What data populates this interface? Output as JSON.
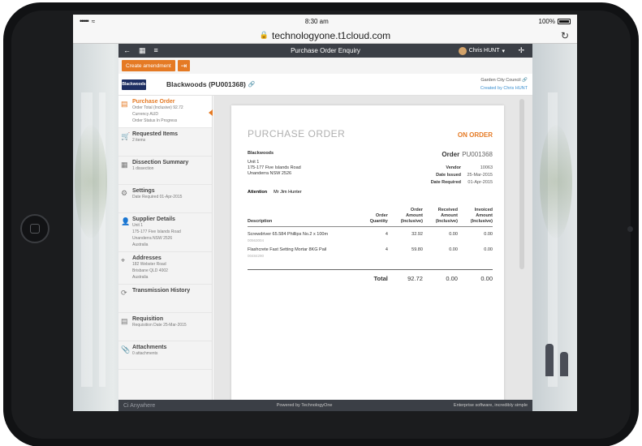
{
  "status_bar": {
    "signal": "•••••",
    "time": "8:30 am",
    "battery": "100%"
  },
  "browser": {
    "url": "technologyone.t1cloud.com"
  },
  "app": {
    "title": "Purchase Order Enquiry",
    "user": "Chris HUNT",
    "actions": {
      "create_amendment": "Create amendment"
    },
    "vendor": {
      "logo_text": "Blackwoods",
      "header": "Blackwoods (PU001368)",
      "org": "Garden City Council",
      "created_by": "Created by Chris HUNT"
    },
    "sidebar": [
      {
        "label": "Purchase Order",
        "icon": "document-icon",
        "lines": [
          "Order Total (Inclusive) 92.72",
          "Currency AUD",
          "Order Status In Progress"
        ]
      },
      {
        "label": "Requested Items",
        "icon": "cart-icon",
        "lines": [
          "2 items"
        ]
      },
      {
        "label": "Dissection Summary",
        "icon": "table-icon",
        "lines": [
          "1 dissection"
        ]
      },
      {
        "label": "Settings",
        "icon": "gear-icon",
        "lines": [
          "Date Required 01-Apr-2015"
        ]
      },
      {
        "label": "Supplier Details",
        "icon": "person-icon",
        "lines": [
          "Unit 1",
          "175-177 Five Islands Road",
          "Unanderra NSW 2526",
          "Australia"
        ]
      },
      {
        "label": "Addresses",
        "icon": "location-icon",
        "lines": [
          "182 Webster Road",
          "Brisbane QLD 4002",
          "Australia"
        ]
      },
      {
        "label": "Transmission History",
        "icon": "transmission-icon",
        "lines": []
      },
      {
        "label": "Requisition",
        "icon": "requisition-icon",
        "lines": [
          "Requisition Date 25-Mar-2015"
        ]
      },
      {
        "label": "Attachments",
        "icon": "paperclip-icon",
        "lines": [
          "0 attachments"
        ]
      }
    ],
    "document": {
      "title": "PURCHASE ORDER",
      "status": "ON ORDER",
      "vendor_name": "Blackwoods",
      "address": [
        "Unit 1",
        "175-177 Five Islands Road",
        "Unanderra NSW 2526"
      ],
      "order_label": "Order",
      "order_no": "PU001368",
      "vendor_label": "Vendor",
      "vendor_no": "10063",
      "date_issued_label": "Date Issued",
      "date_issued": "25-Mar-2015",
      "date_required_label": "Date Required",
      "date_required": "01-Apr-2015",
      "attention_label": "Attention",
      "attention": "Mr Jim Hunter",
      "columns": {
        "description": "Description",
        "qty": [
          "Order",
          "Quantity"
        ],
        "amount": [
          "Order",
          "Amount",
          "(Inclusive)"
        ],
        "received": [
          "Received",
          "Amount",
          "(Inclusive)"
        ],
        "invoiced": [
          "Invoiced",
          "Amount",
          "(Inclusive)"
        ]
      },
      "lines": [
        {
          "description": "Screwdriver 65.584 Phillips No.2 x 100m",
          "code": "00563004",
          "qty": "4",
          "amount": "32.92",
          "received": "0.00",
          "invoiced": "0.00"
        },
        {
          "description": "Flashcrete Fast Setting Mortar 8KG Pail",
          "code": "00484290",
          "qty": "4",
          "amount": "59.80",
          "received": "0.00",
          "invoiced": "0.00"
        }
      ],
      "total": {
        "label": "Total",
        "amount": "92.72",
        "received": "0.00",
        "invoiced": "0.00"
      }
    },
    "footer": {
      "brand": "Ci Anywhere",
      "powered": "Powered by TechnologyOne",
      "tagline": "Enterprise software, incredibly simple"
    }
  }
}
